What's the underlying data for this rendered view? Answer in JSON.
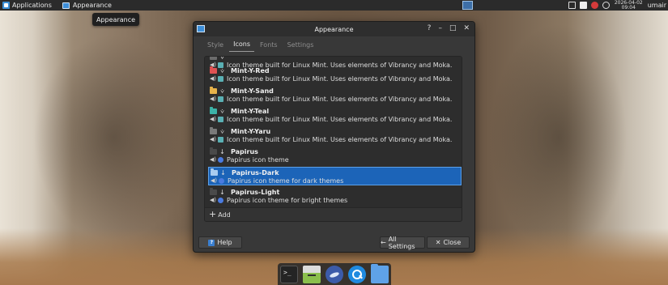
{
  "top_panel": {
    "apps_label": "Applications",
    "task_label": "Appearance",
    "clock_date": "2026-04-02",
    "clock_time": "09:04",
    "user": "umair"
  },
  "tooltip": "Appearance",
  "dialog": {
    "title": "Appearance",
    "controls": {
      "help": "?",
      "minimize": "–",
      "maximize": "□",
      "close": "✕"
    },
    "tabs": [
      {
        "label": "Style",
        "active": false
      },
      {
        "label": "Icons",
        "active": true
      },
      {
        "label": "Fonts",
        "active": false
      },
      {
        "label": "Settings",
        "active": false
      }
    ],
    "themes": [
      {
        "name": "",
        "description": "Icon theme built for Linux Mint. Uses elements of Vibrancy and Moka.",
        "folder_color": "#6b6b6b",
        "badge": "mint",
        "selected": false,
        "partial": true
      },
      {
        "name": "Mint-Y-Red",
        "description": "Icon theme built for Linux Mint. Uses elements of Vibrancy and Moka.",
        "folder_color": "#e05252",
        "badge": "mint",
        "selected": false
      },
      {
        "name": "Mint-Y-Sand",
        "description": "Icon theme built for Linux Mint. Uses elements of Vibrancy and Moka.",
        "folder_color": "#e6b24a",
        "badge": "mint",
        "selected": false
      },
      {
        "name": "Mint-Y-Teal",
        "description": "Icon theme built for Linux Mint. Uses elements of Vibrancy and Moka.",
        "folder_color": "#3cb3a8",
        "badge": "mint",
        "selected": false
      },
      {
        "name": "Mint-Y-Yaru",
        "description": "Icon theme built for Linux Mint. Uses elements of Vibrancy and Moka.",
        "folder_color": "#7a7a7a",
        "badge": "mint",
        "selected": false
      },
      {
        "name": "Papirus",
        "description": "Papirus icon theme",
        "folder_color": "#4a4a4a",
        "badge": "papirus",
        "selected": false
      },
      {
        "name": "Papirus-Dark",
        "description": "Papirus icon theme for dark themes",
        "folder_color": "#a9ccf0",
        "badge": "papirus",
        "selected": true
      },
      {
        "name": "Papirus-Light",
        "description": "Papirus icon theme for bright themes",
        "folder_color": "#4a4a4a",
        "badge": "papirus",
        "selected": false
      }
    ],
    "add_label": "Add",
    "help_label": "Help",
    "all_settings_label": "All Settings",
    "close_label": "Close"
  },
  "colors": {
    "selection": "#1c64b8",
    "mint_badge": "#5ab0b4",
    "papirus_badge": "#4a7be0"
  },
  "dock": {
    "items": [
      "terminal-icon",
      "file-manager-icon",
      "web-browser-icon",
      "search-icon",
      "files-folder-icon"
    ]
  }
}
